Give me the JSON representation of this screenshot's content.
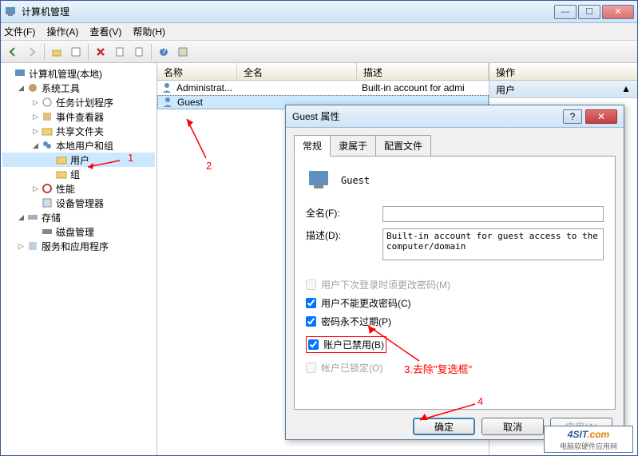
{
  "window": {
    "title": "计算机管理",
    "menu": {
      "file": "文件(F)",
      "action": "操作(A)",
      "view": "查看(V)",
      "help": "帮助(H)"
    },
    "win_buttons": {
      "min": "—",
      "max": "☐",
      "close": "✕"
    }
  },
  "tree": {
    "root": "计算机管理(本地)",
    "sys_tools": "系统工具",
    "task_scheduler": "任务计划程序",
    "event_viewer": "事件查看器",
    "shared_folders": "共享文件夹",
    "local_users": "本地用户和组",
    "users": "用户",
    "groups": "组",
    "performance": "性能",
    "device_mgr": "设备管理器",
    "storage": "存储",
    "disk_mgmt": "磁盘管理",
    "services_apps": "服务和应用程序"
  },
  "list": {
    "cols": {
      "name": "名称",
      "fullname": "全名",
      "desc": "描述"
    },
    "rows": [
      {
        "name": "Administrat...",
        "fullname": "",
        "desc": "Built-in account for admi"
      },
      {
        "name": "Guest",
        "fullname": "",
        "desc": ""
      }
    ]
  },
  "actions": {
    "header": "操作",
    "item": "用户",
    "chevron": "▲"
  },
  "dialog": {
    "title": "Guest 属性",
    "help": "?",
    "close": "✕",
    "tabs": {
      "general": "常规",
      "memberof": "隶属于",
      "profile": "配置文件"
    },
    "username": "Guest",
    "fullname_label": "全名(F):",
    "fullname_value": "",
    "desc_label": "描述(D):",
    "desc_value": "Built-in account for guest access to the computer/domain",
    "chk_mustchange": "用户下次登录时须更改密码(M)",
    "chk_cannotchange": "用户不能更改密码(C)",
    "chk_neverexpires": "密码永不过期(P)",
    "chk_disabled": "账户已禁用(B)",
    "chk_locked": "帐户已锁定(O)",
    "buttons": {
      "ok": "确定",
      "cancel": "取消",
      "apply": "应用(A)"
    }
  },
  "annotations": {
    "a1": "1",
    "a2": "2",
    "a3": "3.去除\"复选框\"",
    "a4": "4"
  },
  "watermark": {
    "brand_main": "4SIT",
    "brand_suffix": ".com",
    "tagline": "电脑软硬件应用网"
  }
}
